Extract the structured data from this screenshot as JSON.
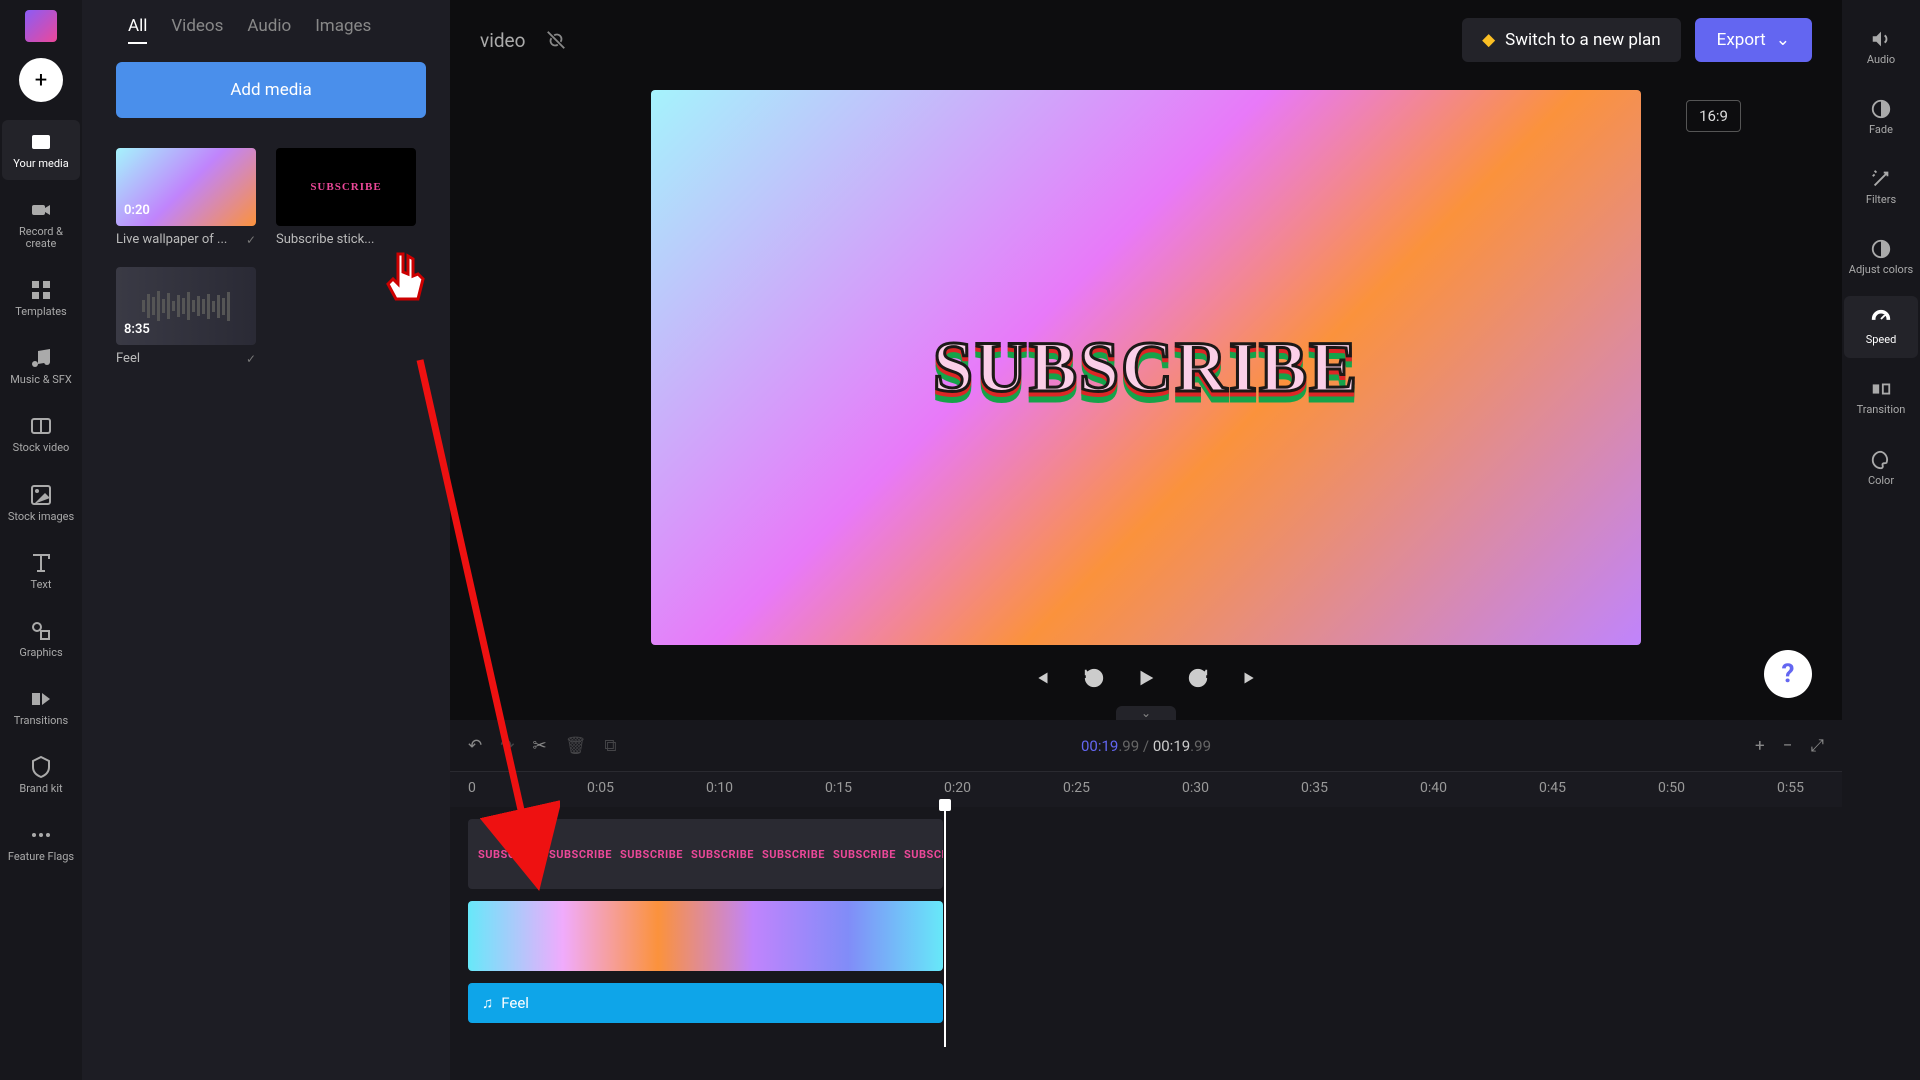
{
  "leftRail": [
    {
      "id": "your-media",
      "label": "Your media"
    },
    {
      "id": "record",
      "label": "Record & create"
    },
    {
      "id": "templates",
      "label": "Templates"
    },
    {
      "id": "music",
      "label": "Music & SFX"
    },
    {
      "id": "stock-video",
      "label": "Stock video"
    },
    {
      "id": "stock-images",
      "label": "Stock images"
    },
    {
      "id": "text",
      "label": "Text"
    },
    {
      "id": "graphics",
      "label": "Graphics"
    },
    {
      "id": "transitions",
      "label": "Transitions"
    },
    {
      "id": "brand-kit",
      "label": "Brand kit"
    },
    {
      "id": "feature-flags",
      "label": "Feature Flags"
    }
  ],
  "mediaTabs": [
    "All",
    "Videos",
    "Audio",
    "Images"
  ],
  "addMediaLabel": "Add media",
  "mediaItems": [
    {
      "name": "Live wallpaper of ...",
      "duration": "0:20",
      "type": "gradient"
    },
    {
      "name": "Subscribe stick...",
      "duration": "",
      "type": "subscribe"
    },
    {
      "name": "Feel",
      "duration": "8:35",
      "type": "audio"
    }
  ],
  "projectName": "video",
  "switchPlanLabel": "Switch to a new plan",
  "exportLabel": "Export",
  "aspectRatio": "16:9",
  "subscribeText": "SUBSCRIBE",
  "rightRail": [
    {
      "id": "audio",
      "label": "Audio"
    },
    {
      "id": "fade",
      "label": "Fade"
    },
    {
      "id": "filters",
      "label": "Filters"
    },
    {
      "id": "adjust-colors",
      "label": "Adjust colors"
    },
    {
      "id": "speed",
      "label": "Speed"
    },
    {
      "id": "transition",
      "label": "Transition"
    },
    {
      "id": "color",
      "label": "Color"
    }
  ],
  "timeline": {
    "currentTime": "00:19",
    "currentFrac": ".99",
    "totalTime": "00:19",
    "totalFrac": ".99",
    "rulerMarks": [
      "0",
      "0:05",
      "0:10",
      "0:15",
      "0:20",
      "0:25",
      "0:30",
      "0:35",
      "0:40",
      "0:45",
      "0:50",
      "0:55"
    ],
    "audioTrackName": "Feel",
    "subscribeRepeat": "SUBSCRIBE"
  },
  "helpSymbol": "?"
}
